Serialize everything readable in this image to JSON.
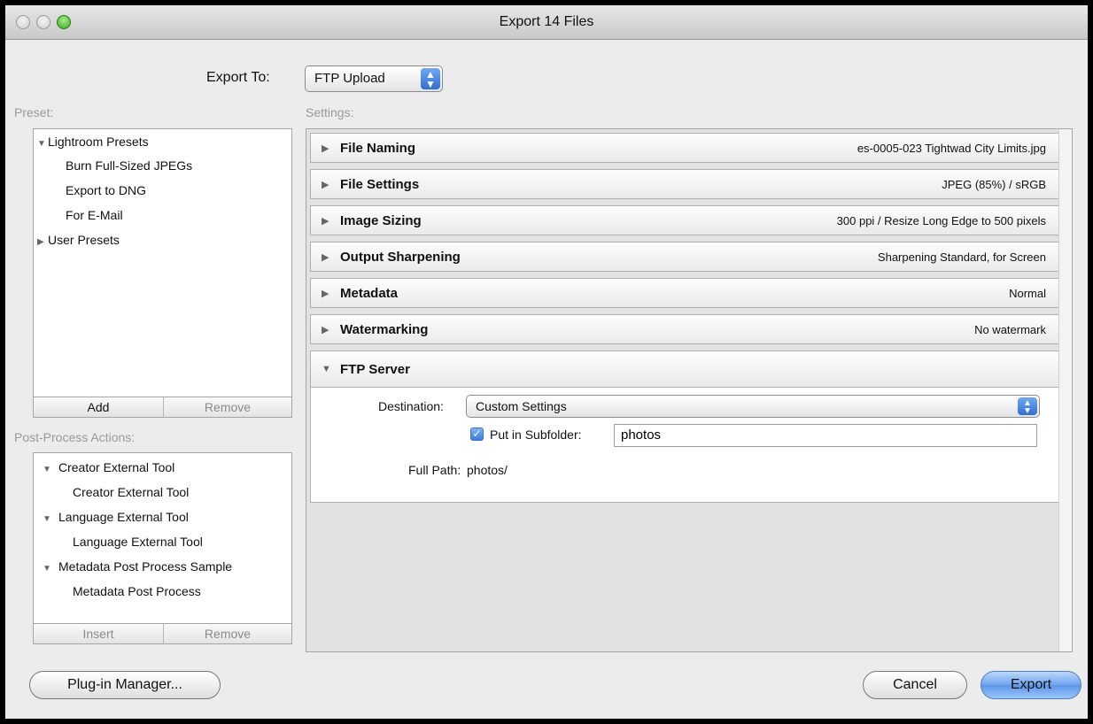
{
  "window": {
    "title": "Export 14 Files"
  },
  "export_to": {
    "label": "Export To:",
    "value": "FTP Upload"
  },
  "preset": {
    "label": "Preset:",
    "groups": [
      {
        "name": "Lightroom Presets",
        "items": [
          "Burn Full-Sized JPEGs",
          "Export to DNG",
          "For E-Mail"
        ]
      },
      {
        "name": "User Presets"
      }
    ],
    "add_label": "Add",
    "remove_label": "Remove"
  },
  "post_process": {
    "label": "Post-Process Actions:",
    "groups": [
      {
        "name": "Creator External Tool",
        "item": "Creator External Tool"
      },
      {
        "name": "Language External Tool",
        "item": "Language External Tool"
      },
      {
        "name": "Metadata Post Process Sample",
        "item": "Metadata Post Process"
      }
    ],
    "insert_label": "Insert",
    "remove_label": "Remove"
  },
  "settings": {
    "label": "Settings:",
    "sections": [
      {
        "name": "File Naming",
        "summary": "es-0005-023 Tightwad City Limits.jpg"
      },
      {
        "name": "File Settings",
        "summary": "JPEG (85%) / sRGB"
      },
      {
        "name": "Image Sizing",
        "summary": "300 ppi / Resize Long Edge to 500 pixels"
      },
      {
        "name": "Output Sharpening",
        "summary": "Sharpening Standard, for Screen"
      },
      {
        "name": "Metadata",
        "summary": "Normal"
      },
      {
        "name": "Watermarking",
        "summary": "No watermark"
      },
      {
        "name": "FTP Server"
      }
    ],
    "ftp": {
      "destination_label": "Destination:",
      "destination_value": "Custom Settings",
      "subfolder_label": "Put in Subfolder:",
      "subfolder_checked": true,
      "subfolder_value": "photos",
      "full_path_label": "Full Path:",
      "full_path_value": "photos/"
    }
  },
  "footer": {
    "plugin_manager_label": "Plug-in Manager...",
    "cancel_label": "Cancel",
    "export_label": "Export"
  }
}
